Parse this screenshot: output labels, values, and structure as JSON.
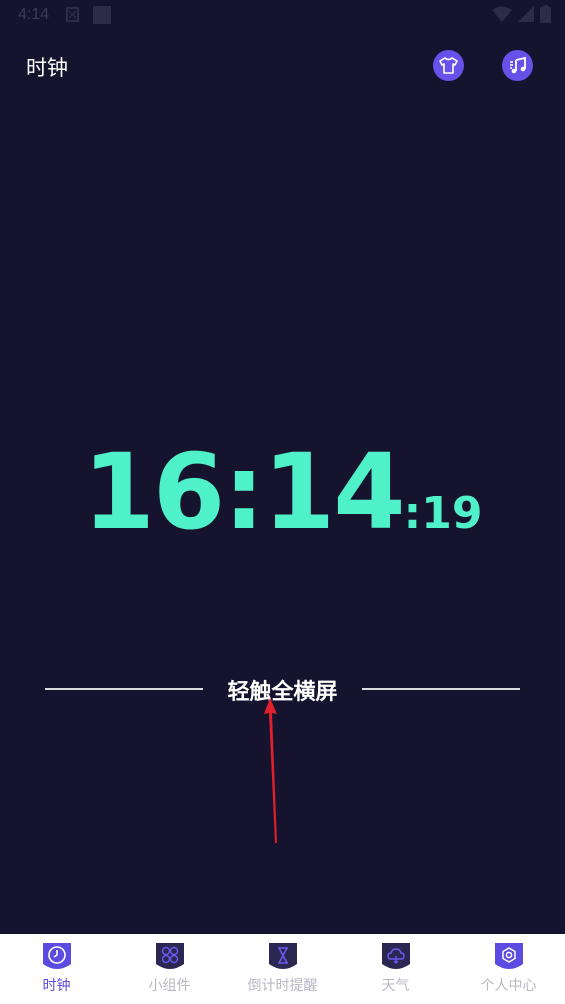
{
  "status_bar": {
    "time": "4:14"
  },
  "header": {
    "title": "时钟",
    "theme_icon": "tshirt-icon",
    "music_icon": "music-note-icon"
  },
  "clock": {
    "hours_minutes": "16:14",
    "seconds": ":19"
  },
  "hint": {
    "text": "轻触全横屏"
  },
  "bottom_nav": {
    "items": [
      {
        "label": "时钟",
        "icon": "clock-icon",
        "active": true
      },
      {
        "label": "小组件",
        "icon": "widgets-icon",
        "active": false
      },
      {
        "label": "倒计时提醒",
        "icon": "hourglass-icon",
        "active": false
      },
      {
        "label": "天气",
        "icon": "cloud-icon",
        "active": false
      },
      {
        "label": "个人中心",
        "icon": "settings-gear-icon",
        "active": false
      }
    ]
  },
  "colors": {
    "background": "#16132e",
    "clock_digits": "#4ff2c8",
    "accent": "#6652e8",
    "annotation_arrow": "#e0202a"
  }
}
